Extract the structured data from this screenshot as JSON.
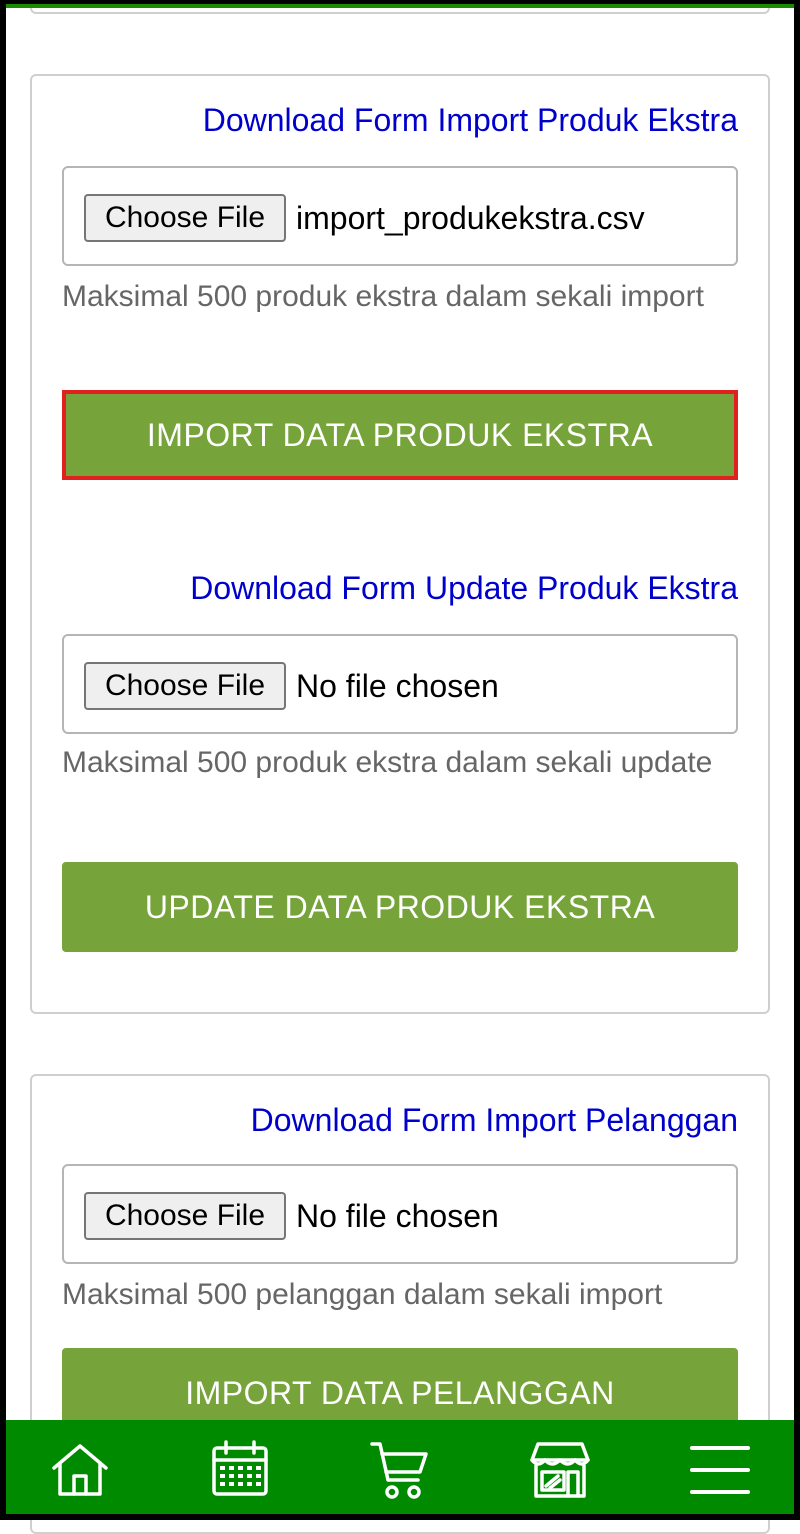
{
  "sections": [
    {
      "link": "Download Form Import Produk Ekstra",
      "choose_label": "Choose File",
      "file_name": "import_produkekstra.csv",
      "hint": "Maksimal 500 produk ekstra dalam sekali import",
      "button": "IMPORT DATA PRODUK EKSTRA"
    },
    {
      "link": "Download Form Update Produk Ekstra",
      "choose_label": "Choose File",
      "file_name": "No file chosen",
      "hint": "Maksimal 500 produk ekstra dalam sekali update",
      "button": "UPDATE DATA PRODUK EKSTRA"
    },
    {
      "link": "Download Form Import Pelanggan",
      "choose_label": "Choose File",
      "file_name": "No file chosen",
      "hint": "Maksimal 500 pelanggan dalam sekali import",
      "button": "IMPORT DATA PELANGGAN"
    }
  ],
  "nav": {
    "icons": [
      "home-icon",
      "calendar-icon",
      "cart-icon",
      "store-icon",
      "menu-icon"
    ]
  },
  "colors": {
    "link": "#0000cc",
    "button": "#76a33a",
    "nav": "#008a00",
    "highlight": "#e0211f"
  }
}
